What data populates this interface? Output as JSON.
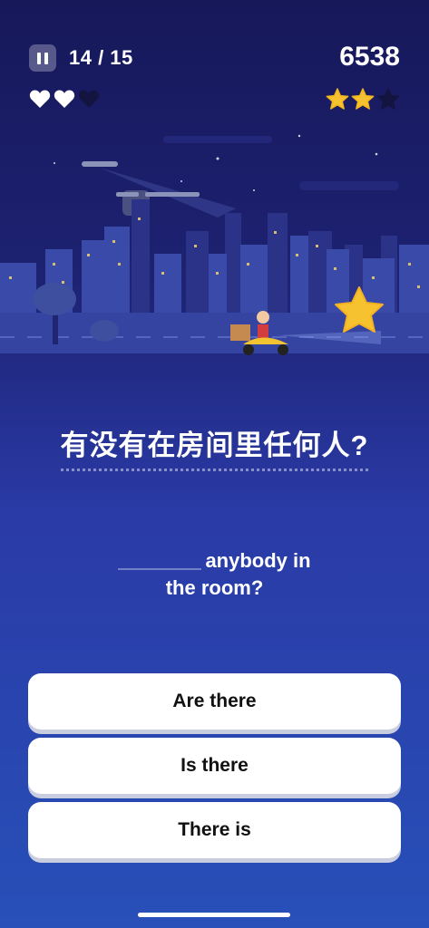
{
  "hud": {
    "progress": "14 / 15",
    "score": "6538",
    "lives_remaining": 2,
    "lives_total": 3,
    "stars_earned": 2,
    "stars_total": 3
  },
  "question": {
    "text": "有没有在房间里任何人?"
  },
  "prompt": {
    "line1": "anybody in",
    "line2": "the room?"
  },
  "answers": [
    {
      "label": "Are there"
    },
    {
      "label": "Is there"
    },
    {
      "label": "There is"
    }
  ],
  "colors": {
    "heart_full": "#ffffff",
    "heart_empty": "#131540",
    "star_gold": "#f7c230",
    "star_empty": "#131540",
    "answer_bg": "#ffffff"
  },
  "icons": {
    "pause": "pause-icon",
    "heart": "heart-icon",
    "star": "star-icon"
  }
}
